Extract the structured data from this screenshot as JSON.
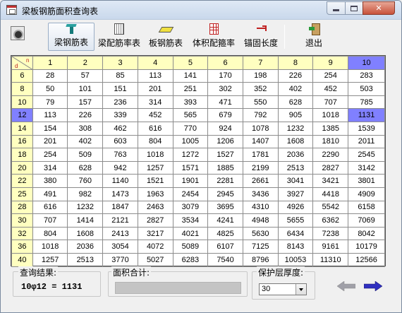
{
  "window": {
    "title": "梁板钢筋面积查询表"
  },
  "toolbar": {
    "items": [
      {
        "label": "梁钢筋表",
        "icon": "beam-icon"
      },
      {
        "label": "梁配筋率表",
        "icon": "ratio-icon"
      },
      {
        "label": "板钢筋表",
        "icon": "plate-icon"
      },
      {
        "label": "体积配箍率",
        "icon": "volume-icon"
      },
      {
        "label": "锚固长度",
        "icon": "anchor-icon"
      },
      {
        "label": "退出",
        "icon": "exit-icon"
      }
    ]
  },
  "grid": {
    "corner": {
      "top": "n",
      "bottom": "d"
    },
    "columns": [
      "1",
      "2",
      "3",
      "4",
      "5",
      "6",
      "7",
      "8",
      "9",
      "10"
    ],
    "rows": [
      {
        "d": "6",
        "values": [
          "28",
          "57",
          "85",
          "113",
          "141",
          "170",
          "198",
          "226",
          "254",
          "283"
        ]
      },
      {
        "d": "8",
        "values": [
          "50",
          "101",
          "151",
          "201",
          "251",
          "302",
          "352",
          "402",
          "452",
          "503"
        ]
      },
      {
        "d": "10",
        "values": [
          "79",
          "157",
          "236",
          "314",
          "393",
          "471",
          "550",
          "628",
          "707",
          "785"
        ]
      },
      {
        "d": "12",
        "values": [
          "113",
          "226",
          "339",
          "452",
          "565",
          "679",
          "792",
          "905",
          "1018",
          "1131"
        ]
      },
      {
        "d": "14",
        "values": [
          "154",
          "308",
          "462",
          "616",
          "770",
          "924",
          "1078",
          "1232",
          "1385",
          "1539"
        ]
      },
      {
        "d": "16",
        "values": [
          "201",
          "402",
          "603",
          "804",
          "1005",
          "1206",
          "1407",
          "1608",
          "1810",
          "2011"
        ]
      },
      {
        "d": "18",
        "values": [
          "254",
          "509",
          "763",
          "1018",
          "1272",
          "1527",
          "1781",
          "2036",
          "2290",
          "2545"
        ]
      },
      {
        "d": "20",
        "values": [
          "314",
          "628",
          "942",
          "1257",
          "1571",
          "1885",
          "2199",
          "2513",
          "2827",
          "3142"
        ]
      },
      {
        "d": "22",
        "values": [
          "380",
          "760",
          "1140",
          "1521",
          "1901",
          "2281",
          "2661",
          "3041",
          "3421",
          "3801"
        ]
      },
      {
        "d": "25",
        "values": [
          "491",
          "982",
          "1473",
          "1963",
          "2454",
          "2945",
          "3436",
          "3927",
          "4418",
          "4909"
        ]
      },
      {
        "d": "28",
        "values": [
          "616",
          "1232",
          "1847",
          "2463",
          "3079",
          "3695",
          "4310",
          "4926",
          "5542",
          "6158"
        ]
      },
      {
        "d": "30",
        "values": [
          "707",
          "1414",
          "2121",
          "2827",
          "3534",
          "4241",
          "4948",
          "5655",
          "6362",
          "7069"
        ]
      },
      {
        "d": "32",
        "values": [
          "804",
          "1608",
          "2413",
          "3217",
          "4021",
          "4825",
          "5630",
          "6434",
          "7238",
          "8042"
        ]
      },
      {
        "d": "36",
        "values": [
          "1018",
          "2036",
          "3054",
          "4072",
          "5089",
          "6107",
          "7125",
          "8143",
          "9161",
          "10179"
        ]
      },
      {
        "d": "40",
        "values": [
          "1257",
          "2513",
          "3770",
          "5027",
          "6283",
          "7540",
          "8796",
          "10053",
          "11310",
          "12566"
        ]
      }
    ],
    "selected_row": 3,
    "selected_col": 9
  },
  "query": {
    "label": "查询结果:",
    "result": "10φ12 = 1131"
  },
  "area_sum": {
    "label": "面积合计:",
    "value": ""
  },
  "cover": {
    "label": "保护层厚度:",
    "value": "30"
  },
  "colors": {
    "header_bg": "#ffffc0",
    "selected_bg": "#8080ff"
  }
}
